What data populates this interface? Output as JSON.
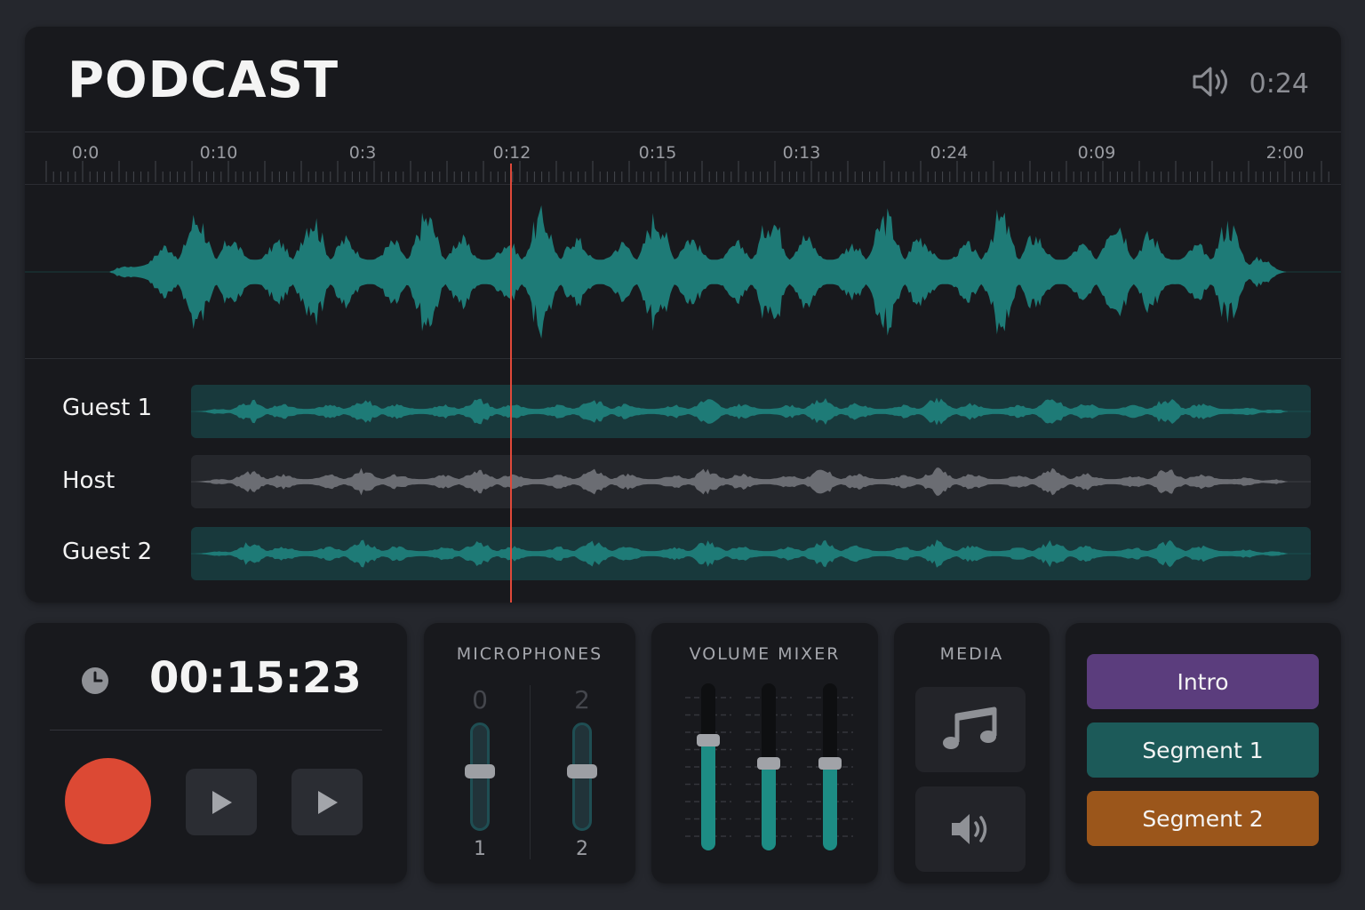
{
  "header": {
    "title": "PODCAST",
    "time": "0:24",
    "speaker_icon": "speaker-icon"
  },
  "timeline": {
    "ticks": [
      {
        "label": "0:0"
      },
      {
        "label": "0:10"
      },
      {
        "label": "0:3"
      },
      {
        "label": "0:12"
      },
      {
        "label": "0:15"
      },
      {
        "label": "0:13"
      },
      {
        "label": "0:24"
      },
      {
        "label": "0:09"
      },
      {
        "label": "2:00"
      }
    ]
  },
  "tracks": [
    {
      "name": "Guest 1",
      "color": "#1e7b77",
      "bg": "#18393c"
    },
    {
      "name": "Host",
      "color": "#6b6d73",
      "bg": "#25272c"
    },
    {
      "name": "Guest 2",
      "color": "#1e7b77",
      "bg": "#18393c"
    }
  ],
  "transport": {
    "timer": "00:15:23",
    "clock_icon": "clock-icon",
    "play_icon": "play-icon"
  },
  "microphones": {
    "title": "MICROPHONES",
    "channels": [
      {
        "top": "0",
        "bottom": "1",
        "level": 0.55
      },
      {
        "top": "2",
        "bottom": "2",
        "level": 0.55
      }
    ]
  },
  "mixer": {
    "title": "VOLUME MIXER",
    "levels": [
      0.66,
      0.52,
      0.52
    ]
  },
  "media": {
    "title": "MEDIA",
    "music_icon": "music-note-icon",
    "sound_icon": "speaker-icon"
  },
  "segments": [
    {
      "label": "Intro",
      "color": "#5b3d7d"
    },
    {
      "label": "Segment 1",
      "color": "#1c5a59"
    },
    {
      "label": "Segment 2",
      "color": "#9b561b"
    }
  ],
  "colors": {
    "accent": "#1e7b77",
    "record": "#dc4934",
    "playhead": "#e0493a"
  }
}
